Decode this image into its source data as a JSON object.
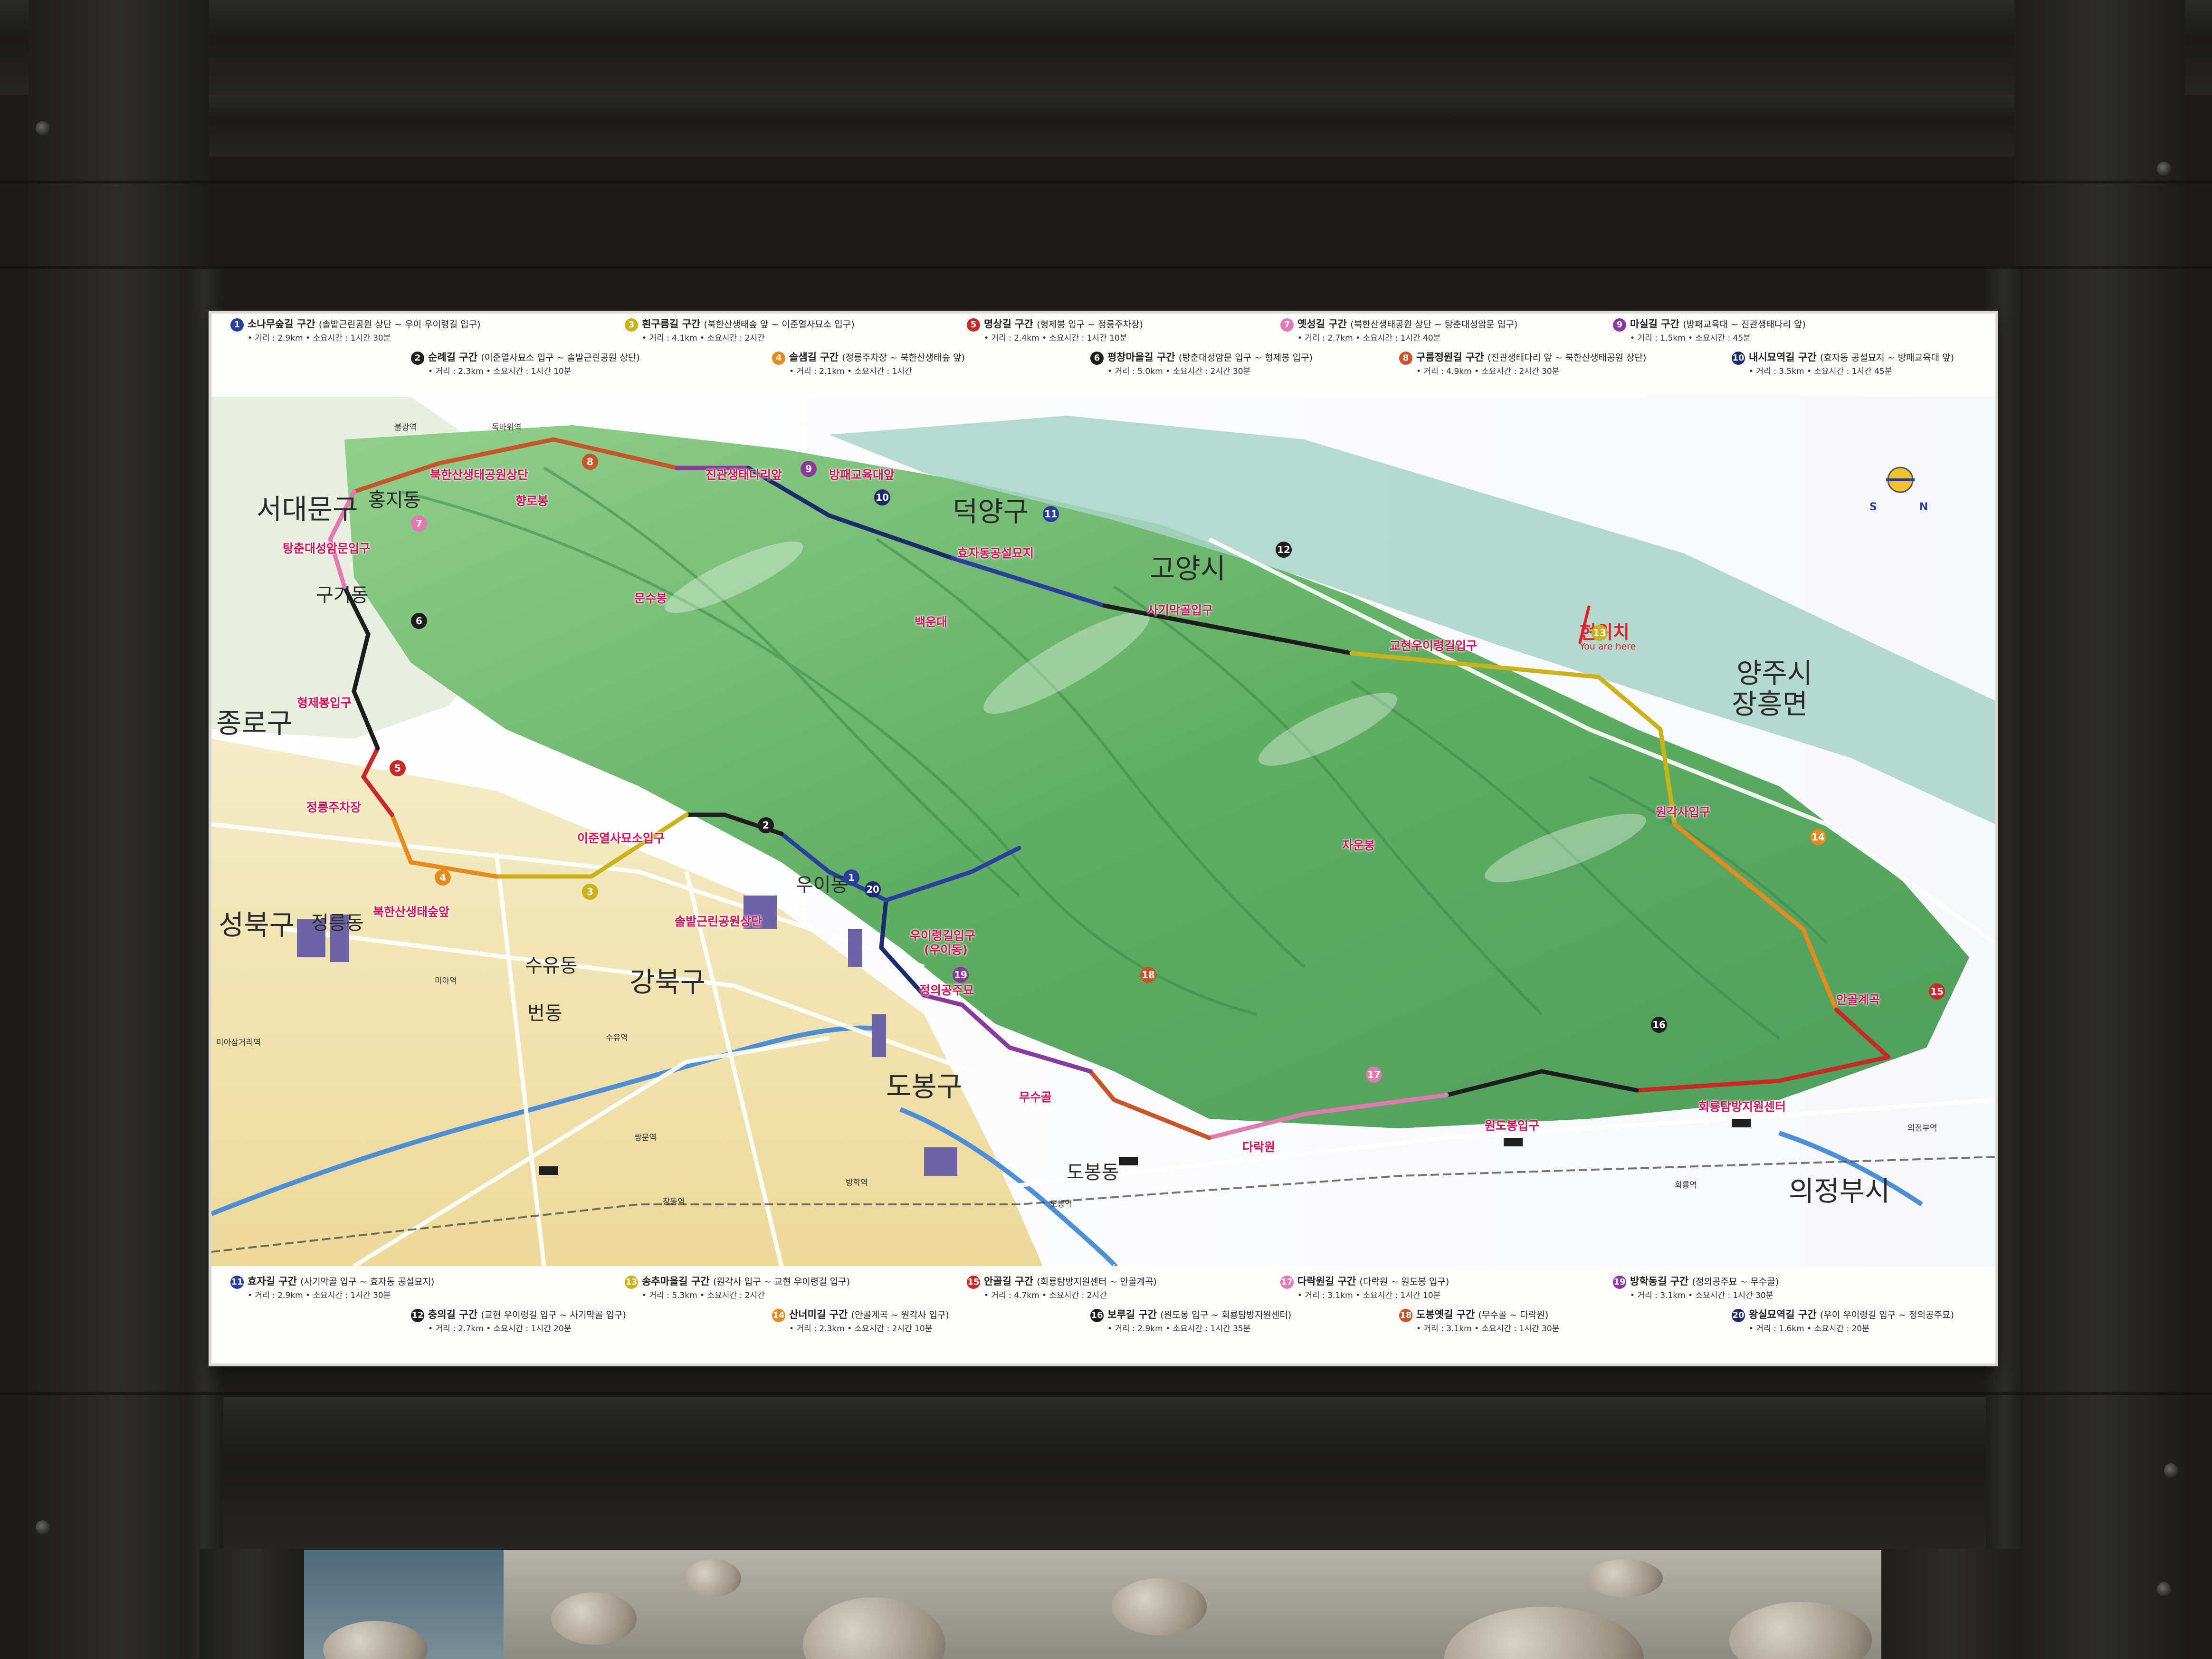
{
  "board": {
    "legend_top": [
      {
        "num": "1",
        "title": "소나무숲길 구간",
        "route": "(솔밭근린공원 상단 ~ 우이 우이령길 입구)",
        "distance": "• 거리 : 2.9km",
        "time": "• 소요시간 : 1시간 30분",
        "color": "#2a3f9c"
      },
      {
        "num": "2",
        "title": "순례길 구간",
        "route": "(이준열사묘소 입구 ~ 솔밭근린공원 상단)",
        "distance": "• 거리 : 2.3km",
        "time": "• 소요시간 : 1시간 10분",
        "color": "#1d1d1d"
      },
      {
        "num": "3",
        "title": "흰구름길 구간",
        "route": "(북한산생태숲 앞 ~ 이준열사묘소 입구)",
        "distance": "• 거리 : 4.1km",
        "time": "• 소요시간 : 2시간",
        "color": "#c9b21a"
      },
      {
        "num": "4",
        "title": "솔샘길 구간",
        "route": "(정릉주차장 ~ 북한산생태숲 앞)",
        "distance": "• 거리 : 2.1km",
        "time": "• 소요시간 : 1시간",
        "color": "#e58a1c"
      },
      {
        "num": "5",
        "title": "명상길 구간",
        "route": "(형제봉 입구 ~ 정릉주차장)",
        "distance": "• 거리 : 2.4km",
        "time": "• 소요시간 : 1시간 10분",
        "color": "#c92828"
      },
      {
        "num": "6",
        "title": "평창마을길 구간",
        "route": "(탕춘대성암문 입구 ~ 형제봉 입구)",
        "distance": "• 거리 : 5.0km",
        "time": "• 소요시간 : 2시간 30분",
        "color": "#1d1d1d"
      },
      {
        "num": "7",
        "title": "옛성길 구간",
        "route": "(북한산생태공원 상단 ~ 탕춘대성암문 입구)",
        "distance": "• 거리 : 2.7km",
        "time": "• 소요시간 : 1시간 40분",
        "color": "#e07ab0"
      },
      {
        "num": "8",
        "title": "구름정원길 구간",
        "route": "(진관생태다리 앞 ~ 북한산생태공원 상단)",
        "distance": "• 거리 : 4.9km",
        "time": "• 소요시간 : 2시간 30분",
        "color": "#c8552a"
      },
      {
        "num": "9",
        "title": "마실길 구간",
        "route": "(방패교육대 ~ 진관생태다리 앞)",
        "distance": "• 거리 : 1.5km",
        "time": "• 소요시간 : 45분",
        "color": "#8a3a9c"
      },
      {
        "num": "10",
        "title": "내시묘역길 구간",
        "route": "(효자동 공설묘지 ~ 방패교육대 앞)",
        "distance": "• 거리 : 3.5km",
        "time": "• 소요시간 : 1시간 45분",
        "color": "#1b2a6a"
      }
    ],
    "legend_bottom": [
      {
        "num": "11",
        "title": "효자길 구간",
        "route": "(사기막골 입구 ~ 효자동 공설묘지)",
        "distance": "• 거리 : 2.9km",
        "time": "• 소요시간 : 1시간 30분",
        "color": "#2a3f9c"
      },
      {
        "num": "12",
        "title": "충의길 구간",
        "route": "(교현 우이령길 입구 ~ 사기막골 입구)",
        "distance": "• 거리 : 2.7km",
        "time": "• 소요시간 : 1시간 20분",
        "color": "#1d1d1d"
      },
      {
        "num": "13",
        "title": "송추마을길 구간",
        "route": "(원각사 입구 ~ 교현 우이령길 입구)",
        "distance": "• 거리 : 5.3km",
        "time": "• 소요시간 : 2시간",
        "color": "#c9b21a"
      },
      {
        "num": "14",
        "title": "산너미길 구간",
        "route": "(안골계곡 ~ 원각사 입구)",
        "distance": "• 거리 : 2.3km",
        "time": "• 소요시간 : 2시간 10분",
        "color": "#e58a1c"
      },
      {
        "num": "15",
        "title": "안골길 구간",
        "route": "(회룡탐방지원센터 ~ 안골계곡)",
        "distance": "• 거리 : 4.7km",
        "time": "• 소요시간 : 2시간",
        "color": "#c92828"
      },
      {
        "num": "16",
        "title": "보루길 구간",
        "route": "(원도봉 입구 ~ 회룡탐방지원센터)",
        "distance": "• 거리 : 2.9km",
        "time": "• 소요시간 : 1시간 35분",
        "color": "#1d1d1d"
      },
      {
        "num": "17",
        "title": "다락원길 구간",
        "route": "(다락원 ~ 원도봉 입구)",
        "distance": "• 거리 : 3.1km",
        "time": "• 소요시간 : 1시간 10분",
        "color": "#e07ab0"
      },
      {
        "num": "18",
        "title": "도봉옛길 구간",
        "route": "(무수골 ~ 다락원)",
        "distance": "• 거리 : 3.1km",
        "time": "• 소요시간 : 1시간 30분",
        "color": "#c8552a"
      },
      {
        "num": "19",
        "title": "방학동길 구간",
        "route": "(정의공주묘 ~ 무수골)",
        "distance": "• 거리 : 3.1km",
        "time": "• 소요시간 : 1시간 30분",
        "color": "#8a3a9c"
      },
      {
        "num": "20",
        "title": "왕실묘역길 구간",
        "route": "(우이 우이령길 입구 ~ 정의공주묘)",
        "distance": "• 거리 : 1.6km",
        "time": "• 소요시간 : 20분",
        "color": "#1b2a6a"
      }
    ],
    "districts": {
      "seodaemun": "서대문구",
      "jongno": "종로구",
      "seongbuk": "성북구",
      "gangbuk": "강북구",
      "dobong": "도봉구",
      "deogyang": "덕양구",
      "goyang": "고양시",
      "yangju": "양주시",
      "jangheung": "장흥면",
      "uijeongbu": "의정부시"
    },
    "neighborhoods": {
      "hongji": "홍지동",
      "gugi": "구기동",
      "jeongneung": "정릉동",
      "suyu": "수유동",
      "beon": "번동",
      "ui": "우이동",
      "dobongdong": "도봉동"
    },
    "pois": {
      "p1": "북한산생태공원상단",
      "p2": "탕춘대성암문입구",
      "p3": "형제봉입구",
      "p4": "정릉주차장",
      "p5": "북한산생태숲앞",
      "p6": "이준열사묘소입구",
      "p7": "솔밭근린공원상단",
      "p8": "우이령길입구",
      "p8b": "(우이동)",
      "p9": "정의공주묘",
      "p10": "무수골",
      "p11": "다락원",
      "p12": "원도봉입구",
      "p13": "회룡탐방지원센터",
      "p14": "안골계곡",
      "p15": "원각사입구",
      "p16": "교현우이령길입구",
      "p17": "사기막골입구",
      "p18": "효자동공설묘지",
      "p19": "방패교육대앞",
      "p20": "진관생태다리앞",
      "p21": "향로봉",
      "p22": "백운대",
      "p23": "문수봉",
      "p24": "자운봉"
    },
    "you_are_here": "현위치",
    "you_are_here_en": "You are here",
    "compass_n": "N",
    "compass_s": "S",
    "stations": [
      "불광역",
      "독바위역",
      "미아역",
      "수유역",
      "쌍문역",
      "도봉역",
      "창동역",
      "방학역",
      "회룡역",
      "의정부역",
      "미아삼거리역"
    ]
  },
  "colors": {
    "forest": "#6fb86a",
    "forest_dark": "#3f8a4a",
    "city": "#f1e5b2",
    "river": "#4d8fd6",
    "board": "#fbfaf6",
    "frame": "#232220"
  }
}
